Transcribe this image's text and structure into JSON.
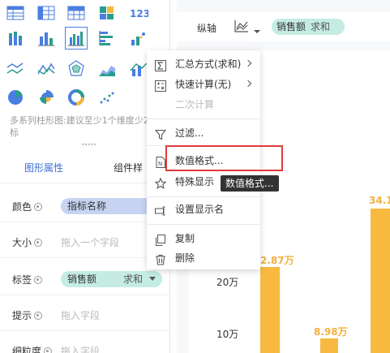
{
  "chart_picker": {
    "icons": [
      {
        "name": "table-icon",
        "row": 0,
        "col": 0
      },
      {
        "name": "cross-table-icon",
        "row": 0,
        "col": 1
      },
      {
        "name": "detail-table-icon",
        "row": 0,
        "col": 2
      },
      {
        "name": "heat-table-icon",
        "row": 0,
        "col": 3
      },
      {
        "name": "kpi-number-icon",
        "row": 0,
        "col": 4,
        "text": "123"
      },
      {
        "name": "stacked-bar-icon",
        "row": 1,
        "col": 0
      },
      {
        "name": "bar-chart-icon",
        "row": 1,
        "col": 1
      },
      {
        "name": "multi-series-bar-icon",
        "row": 1,
        "col": 2,
        "selected": true
      },
      {
        "name": "horizontal-bar-icon",
        "row": 1,
        "col": 3
      },
      {
        "name": "scatter-bar-icon",
        "row": 1,
        "col": 4
      },
      {
        "name": "line-chart-icon",
        "row": 2,
        "col": 0
      },
      {
        "name": "area-line-icon",
        "row": 2,
        "col": 1
      },
      {
        "name": "radar-icon",
        "row": 2,
        "col": 2
      },
      {
        "name": "area-chart-icon",
        "row": 2,
        "col": 3
      },
      {
        "name": "combo-chart-icon",
        "row": 2,
        "col": 4
      },
      {
        "name": "pie-chart-icon",
        "row": 3,
        "col": 0
      },
      {
        "name": "rose-chart-icon",
        "row": 3,
        "col": 1
      },
      {
        "name": "donut-chart-icon",
        "row": 3,
        "col": 2
      },
      {
        "name": "scatter-plot-icon",
        "row": 3,
        "col": 3
      }
    ],
    "hint": "多系列柱形图:建议至少1个维度少2个指标"
  },
  "tabs": {
    "graphic": "图形属性",
    "component": "组件样"
  },
  "properties": [
    {
      "key": "color",
      "label": "颜色",
      "field": "指标名称",
      "type": "blue"
    },
    {
      "key": "size",
      "label": "大小",
      "placeholder": "拖入一个字段"
    },
    {
      "key": "label",
      "label": "标签",
      "field": "销售额",
      "agg": "求和",
      "type": "green"
    },
    {
      "key": "tooltip",
      "label": "提示",
      "placeholder": "拖入字段"
    },
    {
      "key": "detail",
      "label": "细粒度",
      "placeholder": "拖入字段"
    }
  ],
  "axis_bar": {
    "label": "纵轴",
    "field": "销售额",
    "agg": "求和"
  },
  "context_menu": {
    "items": [
      {
        "key": "summary",
        "label": "汇总方式(求和)",
        "icon": "sigma-icon",
        "submenu": true
      },
      {
        "key": "quickcalc",
        "label": "快速计算(无)",
        "icon": "calc-grid-icon",
        "submenu": true
      },
      {
        "key": "secondary",
        "label": "二次计算",
        "disabled": true
      },
      {
        "key": "filter",
        "label": "过滤...",
        "icon": "filter-icon"
      },
      {
        "key": "numformat",
        "label": "数值格式...",
        "icon": "number-format-icon"
      },
      {
        "key": "special",
        "label": "特殊显示",
        "icon": "star-icon"
      },
      {
        "key": "rename",
        "label": "设置显示名",
        "icon": "rename-icon"
      },
      {
        "key": "copy",
        "label": "复制",
        "icon": "copy-icon"
      },
      {
        "key": "delete",
        "label": "删除",
        "icon": "trash-icon"
      }
    ]
  },
  "tooltip_text": "数值格式...",
  "chart_data": {
    "type": "bar",
    "y_ticks": [
      "20万",
      "10万"
    ],
    "data_labels": [
      "2.87万",
      "8.98万",
      "34.1"
    ],
    "colors": {
      "bar": "#f7b93f",
      "label": "#f2b13b"
    }
  }
}
